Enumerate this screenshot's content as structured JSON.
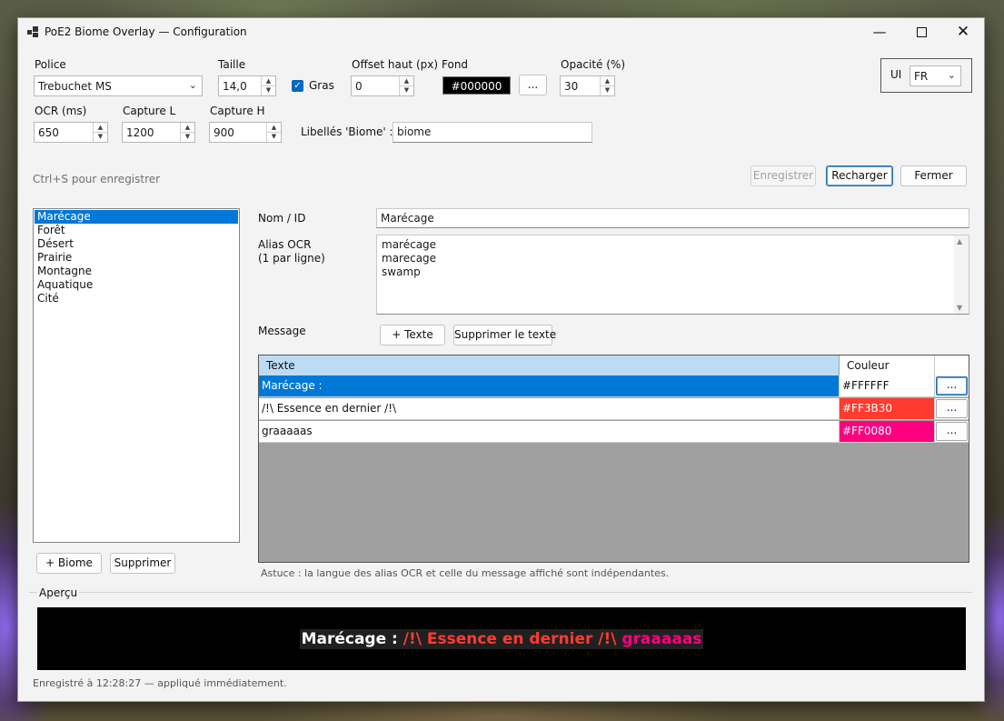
{
  "window": {
    "title": "PoE2 Biome Overlay — Configuration"
  },
  "controls": {
    "font_label": "Police",
    "font_value": "Trebuchet MS",
    "size_label": "Taille",
    "size_value": "14,0",
    "bold_label": "Gras",
    "bold_checked": true,
    "offset_label": "Offset haut (px)",
    "offset_value": "0",
    "bg_label": "Fond",
    "bg_value": "#000000",
    "bg_button": "...",
    "opacity_label": "Opacité (%)",
    "opacity_value": "30",
    "ui_label": "UI",
    "ui_value": "FR",
    "ocr_label": "OCR (ms)",
    "ocr_value": "650",
    "capture_w_label": "Capture L",
    "capture_w_value": "1200",
    "capture_h_label": "Capture H",
    "capture_h_value": "900",
    "biome_labels_label": "Libellés 'Biome' :",
    "biome_labels_value": "biome"
  },
  "hint_save": "Ctrl+S pour enregistrer",
  "actions": {
    "save": "Enregistrer",
    "reload": "Recharger",
    "close": "Fermer"
  },
  "biomes": [
    "Marécage",
    "Forêt",
    "Désert",
    "Prairie",
    "Montagne",
    "Aquatique",
    "Cité"
  ],
  "biome_buttons": {
    "add": "+ Biome",
    "remove": "Supprimer"
  },
  "editor": {
    "name_label": "Nom / ID",
    "name_value": "Marécage",
    "alias_label_1": "Alias OCR",
    "alias_label_2": "(1 par ligne)",
    "aliases": [
      "marécage",
      "marecage",
      "swamp"
    ],
    "message_label": "Message",
    "add_text": "+ Texte",
    "remove_text": "Supprimer le texte"
  },
  "grid": {
    "col_text": "Texte",
    "col_color": "Couleur",
    "rows": [
      {
        "text": "Marécage :",
        "color": "#FFFFFF",
        "btn": "..."
      },
      {
        "text": "/!\\ Essence en dernier /!\\",
        "color": "#FF3B30",
        "btn": "..."
      },
      {
        "text": "graaaaas",
        "color": "#FF0080",
        "btn": "..."
      }
    ]
  },
  "tip": "Astuce : la langue des alias OCR et celle du message affiché sont indépendantes.",
  "preview": {
    "label": "Aperçu",
    "parts": [
      {
        "text": "Marécage :",
        "color": "#FFFFFF"
      },
      {
        "text": "/!\\ Essence en dernier /!\\",
        "color": "#FF3B30"
      },
      {
        "text": "graaaaas",
        "color": "#FF0080"
      }
    ]
  },
  "status": "Enregistré à 12:28:27 — appliqué immédiatement."
}
